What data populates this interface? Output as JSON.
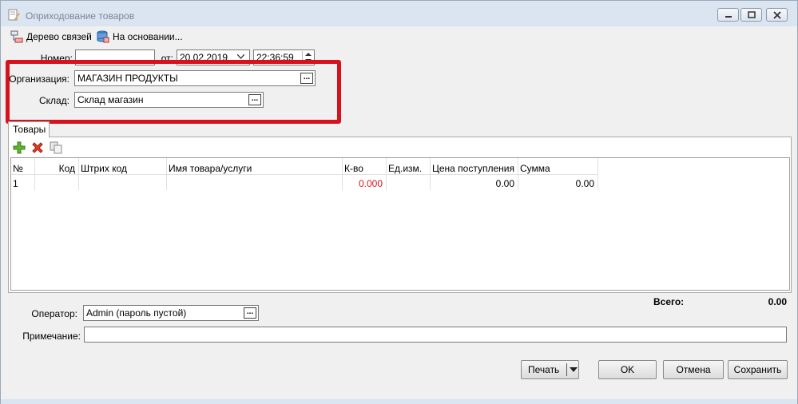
{
  "window": {
    "title": "Оприходование товаров"
  },
  "toolbar": {
    "links_tree": "Дерево связей",
    "based_on": "На основании..."
  },
  "header": {
    "number_label": "Номер:",
    "number_value": "",
    "date_label": "от:",
    "date_value": "20.02.2019",
    "time_value": "22:36:59",
    "org_label": "Организация:",
    "org_value": "МАГАЗИН ПРОДУКТЫ",
    "warehouse_label": "Склад:",
    "warehouse_value": "Склад магазин"
  },
  "tabs": {
    "goods": "Товары"
  },
  "grid": {
    "columns": [
      "№",
      "Код",
      "Штрих код",
      "Имя товара/услуги",
      "К-во",
      "Ед.изм.",
      "Цена поступления",
      "Сумма"
    ],
    "rows": [
      [
        "1",
        "",
        "",
        "",
        "0.000",
        "",
        "0.00",
        "0.00"
      ]
    ]
  },
  "footer": {
    "total_label": "Всего:",
    "total_value": "0.00",
    "operator_label": "Оператор:",
    "operator_value": "Admin (пароль пустой)",
    "note_label": "Примечание:",
    "note_value": ""
  },
  "buttons": {
    "print": "Печать",
    "ok": "OK",
    "cancel": "Отмена",
    "save": "Сохранить"
  },
  "colors": {
    "highlight": "#d8121c",
    "qty_value": "#d8121c"
  }
}
